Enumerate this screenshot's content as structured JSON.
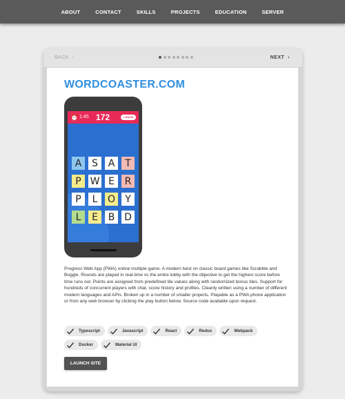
{
  "nav": {
    "items": [
      "ABOUT",
      "CONTACT",
      "SKILLS",
      "PROJECTS",
      "EDUCATION",
      "SERVER"
    ]
  },
  "carousel": {
    "back_label": "BACK",
    "next_label": "NEXT",
    "slide_count": 8,
    "active_index": 0
  },
  "project": {
    "title": "WORDCOASTER.COM",
    "description": "Progress Web App (PWA) online multiple game. A modern twist on classic board games like Scrabble and Boggle. Rounds are played in real-time vs the entire lobby with the objective to get the highest score before time runs out. Points are assigned from predefined tile values along with randomized bonus tiles. Support for hundreds of concurrent players with chat, score history and profiles. Cleanly written using a number of different modern languages and APIs. Broken up in a number of smaller projects. Playable as a PWA phone application or from any web browser by clicking the play button below. Source code available upon request.",
    "tags": [
      "Typescript",
      "Javascript",
      "React",
      "Redux",
      "Webpack",
      "Docker",
      "Material UI"
    ],
    "launch_label": "LAUNCH SITE"
  },
  "phone": {
    "time": "1:45",
    "score": "172",
    "back_label": "< BACK",
    "tiles": [
      [
        "A",
        "S",
        "A",
        "T"
      ],
      [
        "P",
        "W",
        "E",
        "R"
      ],
      [
        "P",
        "L",
        "O",
        "Y"
      ],
      [
        "L",
        "E",
        "B",
        "D"
      ]
    ]
  },
  "colors": {
    "accent": "#2f8fe0",
    "phone_header": "#e82a58",
    "phone_screen": "#2b6fd0",
    "tile_blue": "#8fc6f0",
    "tile_orange": "#f5c79a",
    "tile_pink": "#f3b9b3",
    "tile_yellow": "#f6ec8c",
    "tile_green": "#b4dc8e"
  }
}
